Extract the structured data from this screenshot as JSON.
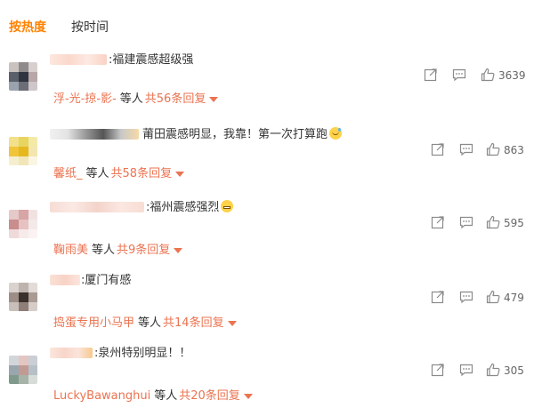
{
  "tabs": {
    "hot": "按热度",
    "time": "按时间"
  },
  "comments": [
    {
      "body": ":福建震感超级强",
      "reply_user": "浮-光-掠-影-",
      "reply_sep": "等人",
      "reply_count": "共56条回复",
      "likes": "3639"
    },
    {
      "body": "莆田震感明显，我靠！第一次打算跑",
      "emoji": "sweat-face-icon",
      "reply_user": "馨纸_",
      "reply_sep": "等人",
      "reply_count": "共58条回复",
      "likes": "863"
    },
    {
      "body": ":福州震感强烈",
      "emoji": "grimace-face-icon",
      "reply_user": "鞠雨美",
      "reply_sep": "等人",
      "reply_count": "共9条回复",
      "likes": "595"
    },
    {
      "body": ":厦门有感",
      "reply_user": "捣蛋专用小马甲",
      "reply_sep": "等人",
      "reply_count": "共14条回复",
      "likes": "479"
    },
    {
      "body": ":泉州特别明显！！",
      "reply_user": "LuckyBawanghui",
      "reply_sep": "等人",
      "reply_count": "共20条回复",
      "likes": "305"
    }
  ],
  "colors": {
    "accent": "#ff8200",
    "reply_link": "#eb7350",
    "icon_gray": "#8a8a8a"
  }
}
